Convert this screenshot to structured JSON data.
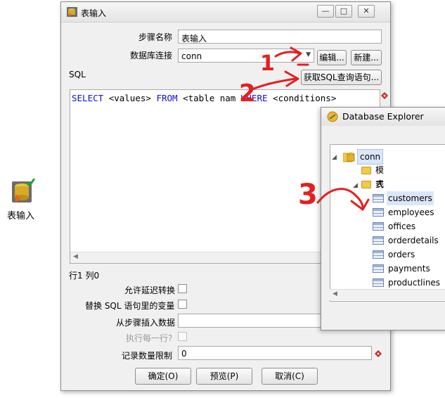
{
  "canvas": {
    "step_label": "表输入"
  },
  "dialog": {
    "title": "表输入",
    "step_name_label": "步骤名称",
    "step_name_value": "表输入",
    "connection_label": "数据库连接",
    "connection_value": "conn",
    "edit_button": "编辑...",
    "new_button": "新建...",
    "sql_label": "SQL",
    "get_sql_button": "获取SQL查询语句...",
    "sql": {
      "kw_select": "SELECT",
      "values": "<values>",
      "kw_from": "FROM",
      "table": "<table nam",
      "kw_where": "WHERE",
      "conditions": "<conditions>"
    },
    "position": "行1 列0",
    "lazy_conversion_label": "允许延迟转换",
    "replace_vars_label": "替换 SQL 语句里的变量",
    "insert_from_step_label": "从步骤插入数据",
    "execute_each_row_label": "执行每一行?",
    "limit_label": "记录数量限制",
    "limit_value": "0",
    "ok_button": "确定(O)",
    "preview_button": "预览(P)",
    "cancel_button": "取消(C)"
  },
  "explorer": {
    "title": "Database Explorer",
    "root": "conn",
    "schemas": "模式",
    "tables_label": "表",
    "tables": [
      "customers",
      "employees",
      "offices",
      "orderdetails",
      "orders",
      "payments",
      "productlines"
    ]
  },
  "annotations": {
    "one": "1",
    "two": "2",
    "three": "3"
  },
  "colors": {
    "annotation": "#e41f1f",
    "keyword": "#1010d0",
    "selection": "#dbe7f8"
  }
}
